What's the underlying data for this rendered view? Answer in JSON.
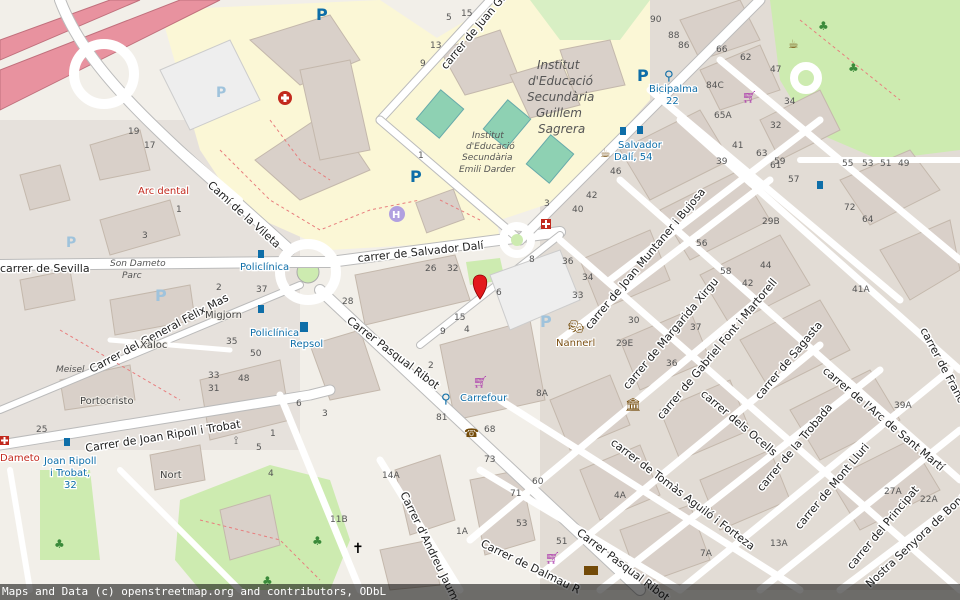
{
  "streets": {
    "salvador_dali": "carrer de Salvador Dalí",
    "cami_vileta": "Camí de la Vileta",
    "sevilla": "carrer de Sevilla",
    "felix_mas": "Carrer del General Fèlix Mas",
    "ripoll": "Carrer de Joan Ripoll i Trobat",
    "pasqual_ribot_1": "Carrer Pasqual Ribot",
    "pasqual_ribot_2": "Carrer Pasqual Ribot",
    "juan_gris": "carrer de Juan Gris",
    "muntaner": "carrer de Joan Muntaner i Bujosa",
    "xirgu": "carrer de Margarida Xirgu",
    "font": "carrer de Gabriel Font i Martorell",
    "ocells": "carrer dels Ocells",
    "sagasta": "carrer de Sagasta",
    "aguilo": "carrer de Tomàs Aguiló i Forteza",
    "trobada": "carrer de la Trobada",
    "arc": "carrer de l'Arc de Sant Martí",
    "lluri": "carrer de Mont Lluri",
    "principat": "carrer del Principat",
    "bonany": "Nostra Senyora de Bonany",
    "andreu": "Carrer d'Andreu Jaume",
    "dalmau": "Carrer de Dalmau R",
    "francesc": "carrer de Franc"
  },
  "places": {
    "school_big": [
      "Institut",
      "d'Educació",
      "Secundària",
      "Guillem",
      "Sagrera"
    ],
    "school_small": [
      "Institut",
      "d'Educació",
      "Secundària",
      "Emili Darder"
    ],
    "son_dameto": [
      "Son Dameto",
      "Parc"
    ],
    "migjorn": "Migjorn",
    "xaloc": "Xaloc",
    "meisel": "Meisel",
    "portocristo": "Portocristo",
    "nort": "Nort"
  },
  "pois": {
    "arc_dental": "Arc dental",
    "policlinica_1": "Policlínica",
    "policlinica_2": "Policlínica",
    "repsol": "Repsol",
    "carrefour": "Carrefour",
    "nannerl": "Nannerl",
    "bicipalma": [
      "Bicipalma",
      "22"
    ],
    "salvador_dali_stop": [
      "Salvador",
      "Dalí, 54"
    ],
    "ripoll_stop": [
      "Joan Ripoll",
      "i Trobat,",
      "32"
    ],
    "dameto": "Dameto"
  },
  "house_numbers": {
    "a": "13",
    "b": "9",
    "c": "5",
    "d": "15",
    "e": "90",
    "f": "88",
    "g": "86",
    "h": "66",
    "i": "62",
    "j": "47",
    "k": "84C",
    "l": "65A",
    "m": "34",
    "n": "32",
    "o": "41",
    "p": "39",
    "q": "63",
    "r": "61",
    "s": "59",
    "t": "57",
    "u": "55",
    "v": "53",
    "w": "51",
    "x": "49",
    "y": "46",
    "z": "42",
    "aa": "40",
    "ab": "36",
    "ac": "34",
    "ad": "33",
    "ae": "30",
    "af": "29E",
    "ag": "8",
    "ah": "26",
    "ai": "32",
    "aj": "28",
    "ak": "15",
    "al": "9",
    "am": "4",
    "an": "6",
    "ao": "19",
    "ap": "17",
    "aq": "37",
    "ar": "2",
    "as": "35",
    "at": "50",
    "au": "48",
    "av": "33",
    "aw": "31",
    "ax": "1",
    "ay": "3",
    "az": "81",
    "ba": "73",
    "bb": "71",
    "bc": "68",
    "bd": "60",
    "be": "53",
    "bf": "51",
    "bg": "11B",
    "bh": "14A",
    "bi": "1A",
    "bj": "7A",
    "bk": "13A",
    "bl": "22A",
    "bm": "27A",
    "bn": "39A",
    "bo": "41A",
    "bp": "72",
    "bq": "64",
    "br": "8A",
    "bs": "4A",
    "bt": "1",
    "bu": "5",
    "bv": "4",
    "bw": "6",
    "bx": "3",
    "by": "25",
    "bz": "2",
    "ca": "1",
    "cb": "3",
    "cc": "29B",
    "cd": "56",
    "ce": "44",
    "cf": "58",
    "cg": "42",
    "ch": "37",
    "ci": "36"
  },
  "attribution": "Maps and Data (c) openstreetmap.org and contributors, ODbL"
}
